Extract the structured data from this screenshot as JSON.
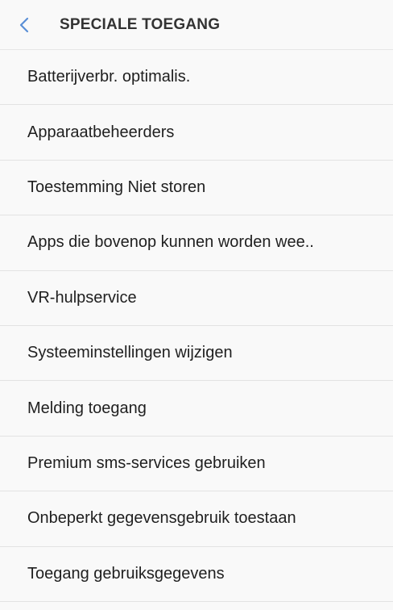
{
  "header": {
    "title": "SPECIALE TOEGANG",
    "back_icon": "chevron-left-icon",
    "accent_color": "#5a8fd6"
  },
  "items": [
    {
      "label": "Batterijverbr. optimalis."
    },
    {
      "label": "Apparaatbeheerders"
    },
    {
      "label": "Toestemming Niet storen"
    },
    {
      "label": "Apps die bovenop kunnen worden wee.."
    },
    {
      "label": "VR-hulpservice"
    },
    {
      "label": "Systeeminstellingen wijzigen"
    },
    {
      "label": "Melding toegang"
    },
    {
      "label": "Premium sms-services gebruiken"
    },
    {
      "label": "Onbeperkt gegevensgebruik toestaan"
    },
    {
      "label": "Toegang gebruiksgegevens"
    }
  ]
}
